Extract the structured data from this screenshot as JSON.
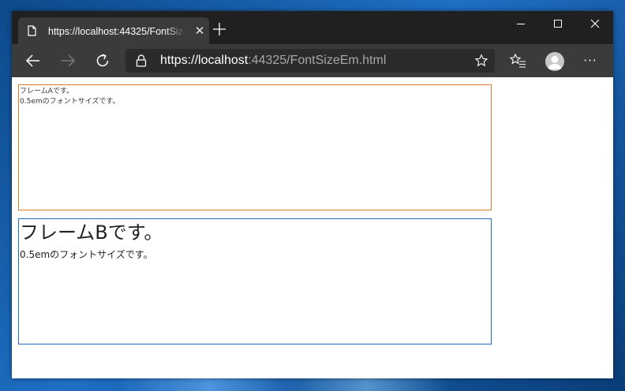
{
  "colors": {
    "tabbar_bg": "#202020",
    "toolbar_bg": "#3b3b3b",
    "frame_a_border": "#e07b2a",
    "frame_b_border": "#1f6cc0"
  },
  "tab": {
    "title": "https://localhost:44325/FontSizeEm.html",
    "icon": "page-icon",
    "close_label": "✕"
  },
  "window_controls": [
    "minimize-icon",
    "maximize-icon",
    "close-icon"
  ],
  "toolbar": {
    "icons": [
      "back-arrow-icon",
      "forward-arrow-icon",
      "refresh-icon",
      "star-icon",
      "favorites-icon",
      "profile-icon",
      "more-icon"
    ],
    "more_label": "···"
  },
  "address": {
    "scheme": "https://",
    "host": "localhost",
    "rest": ":44325/FontSizeEm.html"
  },
  "page": {
    "frame_a": {
      "line1": "フレームAです。",
      "line2": "0.5emのフォントサイズです。"
    },
    "frame_b": {
      "title": "フレームBです。",
      "line": "0.5emのフォントサイズです。"
    }
  }
}
